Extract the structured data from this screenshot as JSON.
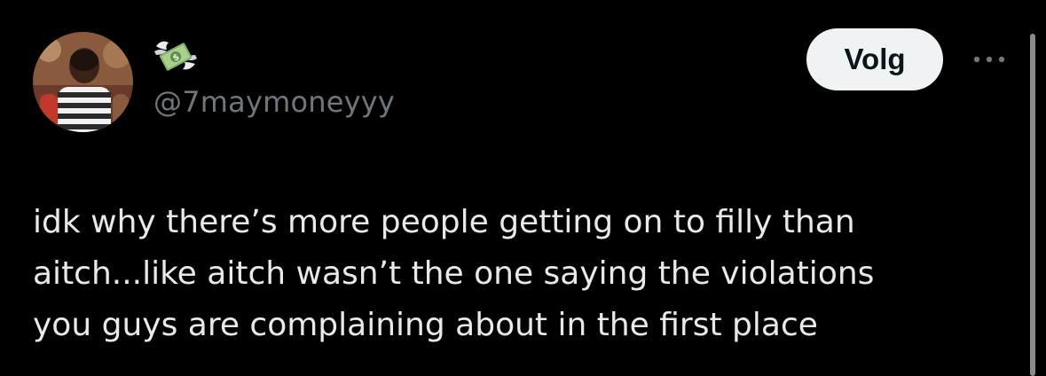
{
  "author": {
    "display_emoji": "money-with-wings-icon",
    "handle": "@7maymoneyyy"
  },
  "actions": {
    "follow_label": "Volg"
  },
  "tweet": {
    "lines": [
      "idk why there’s more people getting on to filly than",
      "aitch...like aitch wasn’t the one saying the violations",
      "you guys are complaining about in the first place"
    ]
  },
  "colors": {
    "background": "#000000",
    "text": "#e7e9ea",
    "secondary_text": "#71767b",
    "follow_button_bg": "#eff3f4",
    "follow_button_text": "#0f1419"
  }
}
